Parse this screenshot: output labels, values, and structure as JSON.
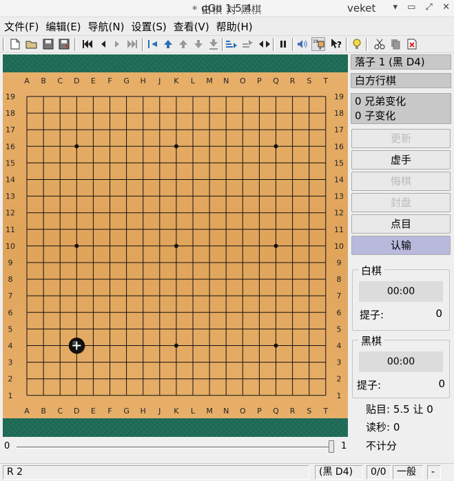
{
  "window": {
    "title": "* 白棋 对 黑棋",
    "app_version": "qGo 1.5.4",
    "user": "veket"
  },
  "menu": [
    "文件(F)",
    "编辑(E)",
    "导航(N)",
    "设置(S)",
    "查看(V)",
    "帮助(H)"
  ],
  "board": {
    "size": 19,
    "columns": [
      "A",
      "B",
      "C",
      "D",
      "E",
      "F",
      "G",
      "H",
      "J",
      "K",
      "L",
      "M",
      "N",
      "O",
      "P",
      "Q",
      "R",
      "S",
      "T"
    ],
    "rows": [
      "19",
      "18",
      "17",
      "16",
      "15",
      "14",
      "13",
      "12",
      "11",
      "10",
      "9",
      "8",
      "7",
      "6",
      "5",
      "4",
      "3",
      "2",
      "1"
    ],
    "stones": [
      {
        "color": "black",
        "point": "D4",
        "last_move": true
      }
    ]
  },
  "slider": {
    "min": "0",
    "max": "1",
    "value": 1
  },
  "info": {
    "move": "落子  1 (黑 D4)",
    "to_play": "白方行棋",
    "siblings": "0 兄弟变化",
    "sons": "0 子变化"
  },
  "buttons": {
    "update": "更新",
    "pass": "虚手",
    "undo": "悔棋",
    "adjourn": "封盘",
    "score": "点目",
    "resign": "认输"
  },
  "white": {
    "label": "白棋",
    "time": "00:00",
    "captures_label": "提子:",
    "captures": "0"
  },
  "black": {
    "label": "黑棋",
    "time": "00:00",
    "captures_label": "提子:",
    "captures": "0"
  },
  "game": {
    "komi": "贴目: 5.5 让 0",
    "byoyomi": "读秒: 0",
    "free": "不计分"
  },
  "status": {
    "rank": "R 2",
    "last_move": "(黑 D4)",
    "captures": "0/0",
    "game_type": "一般",
    "extra": "-"
  }
}
